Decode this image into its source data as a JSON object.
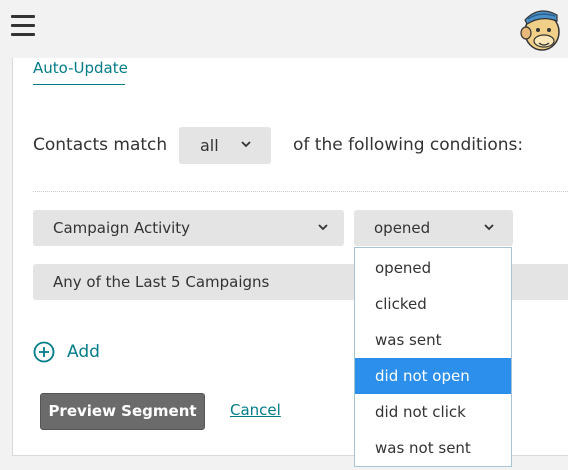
{
  "header": {
    "menu_icon": "hamburger-menu-icon",
    "avatar_icon": "freddie-monkey-avatar-icon"
  },
  "tab": {
    "label": "Auto-Update"
  },
  "match": {
    "prefix": "Contacts match",
    "selected": "all",
    "suffix": "of the following conditions:"
  },
  "condition": {
    "field": "Campaign Activity",
    "operator": "opened",
    "scope": "Any of the Last 5 Campaigns"
  },
  "operator_options": {
    "items": [
      "opened",
      "clicked",
      "was sent",
      "did not open",
      "did not click",
      "was not sent"
    ],
    "highlighted": "did not open"
  },
  "actions": {
    "add_label": "Add",
    "preview_label": "Preview Segment",
    "cancel_label": "Cancel"
  },
  "colors": {
    "link": "#007c89",
    "highlight": "#2d8fec",
    "select_bg": "#e4e4e4",
    "primary_button": "#6b6b6b"
  }
}
